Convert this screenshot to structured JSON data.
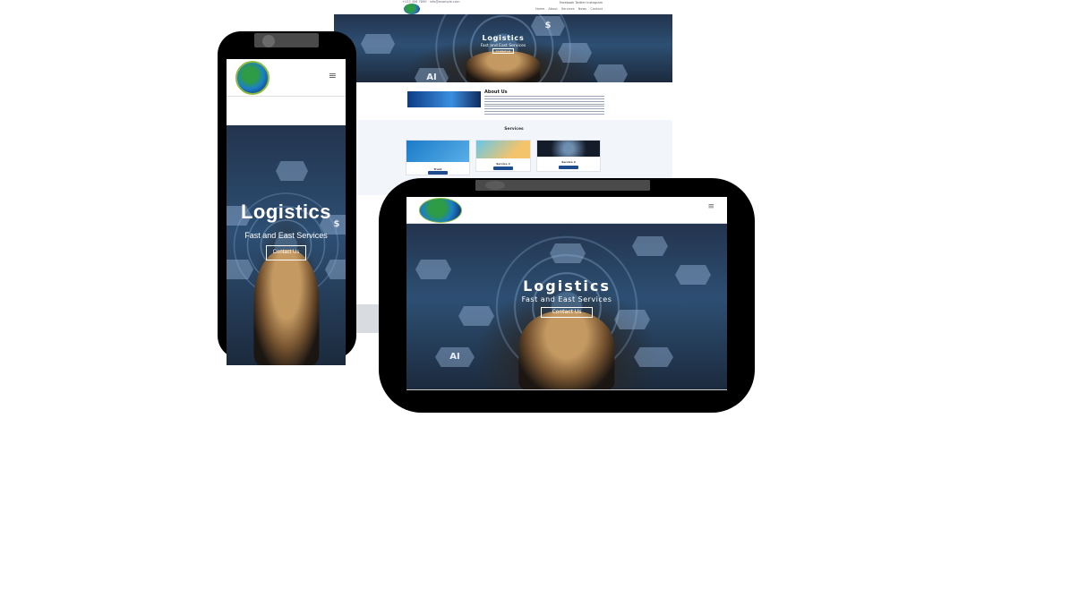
{
  "desktop": {
    "contact_line": "+123 456 7890 · info@example.com",
    "social": [
      "Facebook",
      "Twitter",
      "Instagram"
    ],
    "nav": [
      "Home",
      "About",
      "Services",
      "News",
      "Contact"
    ],
    "hero": {
      "title": "Logistics",
      "subtitle": "Fast and East Services",
      "cta": "Contact Us"
    },
    "about": {
      "title": "About Us"
    },
    "services": {
      "title": "Services",
      "cards": [
        {
          "caption": "Truck",
          "button": "Read More"
        },
        {
          "caption": "Service 1",
          "button": "Read More"
        },
        {
          "caption": "Service 2",
          "button": "Read More"
        }
      ]
    }
  },
  "phone": {
    "menu_icon": "hamburger-icon",
    "hero": {
      "title": "Logistics",
      "subtitle": "Fast and East Services",
      "cta": "Contact Us"
    }
  },
  "tablet": {
    "menu_icon": "hamburger-icon",
    "hero": {
      "title": "Logistics",
      "subtitle": "Fast and East Services",
      "cta": "Contact Us"
    }
  },
  "hero_icons": [
    "AI",
    "$"
  ],
  "colors": {
    "primary": "#1f4b8f",
    "device": "#000000",
    "logo_green": "#2e9b46",
    "logo_blue": "#1b80c8"
  }
}
